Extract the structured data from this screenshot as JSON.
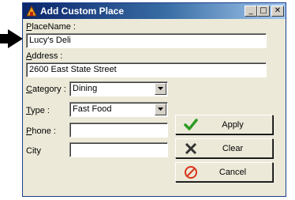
{
  "window": {
    "title": "Add Custom Place",
    "minimize_glyph": "_",
    "maximize_glyph": "□",
    "close_glyph": "✕"
  },
  "form": {
    "placename": {
      "label_key": "P",
      "label_rest": "laceName :",
      "value": "Lucy's Deli"
    },
    "address": {
      "label_key": "A",
      "label_rest": "ddress :",
      "value": "2600 East State Street"
    },
    "category": {
      "label_key": "C",
      "label_rest": "ategory :",
      "value": "Dining"
    },
    "type": {
      "label_key": "T",
      "label_rest": "ype :",
      "value": "Fast Food"
    },
    "phone": {
      "label_key": "P",
      "label_rest": "hone :",
      "value": ""
    },
    "city": {
      "label": "City",
      "value": ""
    }
  },
  "buttons": {
    "apply": {
      "label": "Apply",
      "icon": "checkmark-icon"
    },
    "clear": {
      "label": "Clear",
      "icon": "x-icon"
    },
    "cancel": {
      "label": "Cancel",
      "icon": "no-entry-icon"
    }
  },
  "colors": {
    "title_bar_start": "#0a246a",
    "title_bar_end": "#a6caf0",
    "dialog_bg": "#ece9d8",
    "apply_icon": "#2e9b24",
    "cancel_icon": "#d9341e"
  }
}
